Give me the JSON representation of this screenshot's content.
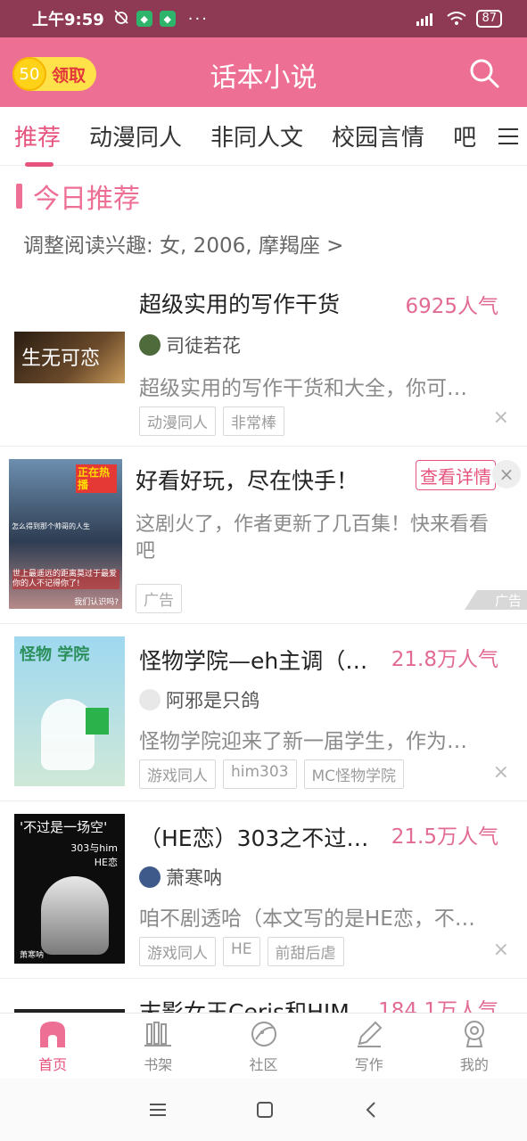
{
  "status_bar": {
    "time": "上午9:59",
    "dots": "···",
    "battery": "87"
  },
  "header": {
    "coin_amount": "50",
    "coin_label": "领取",
    "title": "话本小说"
  },
  "tabs": [
    {
      "label": "推荐"
    },
    {
      "label": "动漫同人"
    },
    {
      "label": "非同人文"
    },
    {
      "label": "校园言情"
    },
    {
      "label": "吧"
    }
  ],
  "section": {
    "title": "今日推荐",
    "interest": "调整阅读兴趣: 女, 2006, 摩羯座 >"
  },
  "stories": [
    {
      "title": "超级实用的写作干货",
      "popularity": "6925人气",
      "author": "司徒若花",
      "desc": "超级实用的写作干货和大全，你可…",
      "tags": [
        "动漫同人",
        "非常棒"
      ],
      "cover_text": "生无可恋"
    },
    {
      "title": "怪物学院—eh主调（…",
      "popularity": "21.8万人气",
      "author": "阿邪是只鸽",
      "desc": "怪物学院迎来了新一届学生，作为…",
      "tags": [
        "游戏同人",
        "him303",
        "MC怪物学院"
      ],
      "cover_text": "怪物 学院"
    },
    {
      "title": "（HE恋）303之不过…",
      "popularity": "21.5万人气",
      "author": "萧寒呐",
      "desc": "咱不剧透哈（本文写的是HE恋，不…",
      "tags": [
        "游戏同人",
        "HE",
        "前甜后虐"
      ],
      "cover_text": "'不过是一场空'",
      "cover_sub": "303与him HE恋",
      "cover_author": "萧寒呐"
    },
    {
      "title": "末影女王Ceris和HIM",
      "popularity": "184.1万人气"
    }
  ],
  "ad": {
    "title": "好看好玩，尽在快手！",
    "button": "查看详情",
    "desc": "这剧火了，作者更新了几百集！快来看看吧",
    "chip": "广告",
    "mark": "广告",
    "cover_badge": "正在热播",
    "cover_caption1": "怎么得到那个帅哥的人生",
    "cover_caption2": "世上最遥远的距离莫过于最爱你的人不记得你了!",
    "cover_caption3": "我们认识吗?"
  },
  "bottom_nav": [
    {
      "label": "首页",
      "icon": "home-icon",
      "active": true
    },
    {
      "label": "书架",
      "icon": "bookshelf-icon"
    },
    {
      "label": "社区",
      "icon": "community-icon"
    },
    {
      "label": "写作",
      "icon": "pen-icon"
    },
    {
      "label": "我的",
      "icon": "profile-icon"
    }
  ],
  "colors": {
    "brand": "#ee6f94",
    "accent": "#e6547d",
    "status_bar": "#8e3a55"
  },
  "close_glyph": "×"
}
